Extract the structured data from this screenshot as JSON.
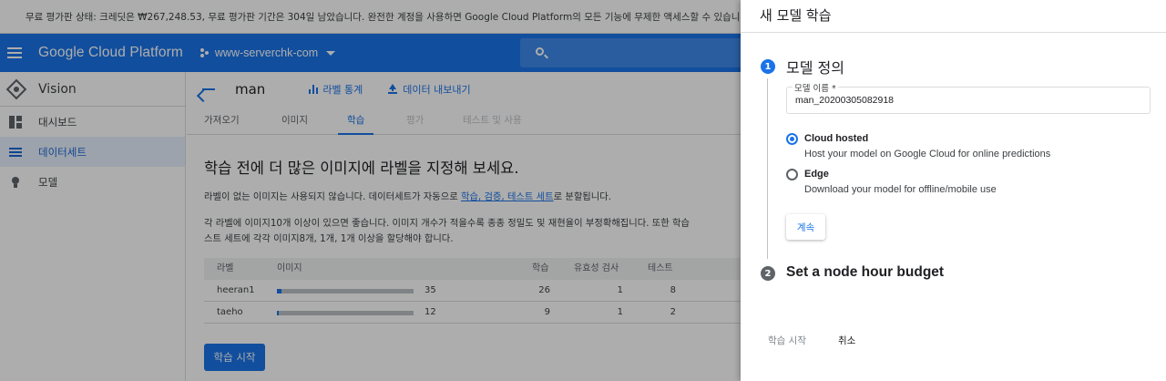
{
  "banner": {
    "text": "무료 평가판 상태: 크레딧은 ₩267,248.53, 무료 평가판 기간은 304일 남았습니다. 완전한 계정을 사용하면 Google Cloud Platform의 모든 기능에 무제한 액세스할 수 있습니다."
  },
  "topbar": {
    "title": "Google Cloud Platform",
    "project": "www-serverchk-com"
  },
  "sidebar": {
    "product": "Vision",
    "items": [
      {
        "label": "대시보드"
      },
      {
        "label": "데이터세트",
        "active": true
      },
      {
        "label": "모델"
      }
    ]
  },
  "header": {
    "dataset": "man",
    "stats_label": "라벨 통계",
    "export_label": "데이터 내보내기"
  },
  "tabs": [
    {
      "label": "가져오기"
    },
    {
      "label": "이미지"
    },
    {
      "label": "학습",
      "active": true
    },
    {
      "label": "평가",
      "disabled": true
    },
    {
      "label": "테스트 및 사용",
      "disabled": true
    }
  ],
  "main": {
    "heading": "학습 전에 더 많은 이미지에 라벨을 지정해 보세요.",
    "para1_before": "라벨이 없는 이미지는 사용되지 않습니다. 데이터세트가 자동으로 ",
    "para1_link": "학습, 검증, 테스트 세트",
    "para1_after": "로 분할됩니다.",
    "para2_line1": "각 라벨에 이미지10개 이상이 있으면 좋습니다. 이미지 개수가 적을수록 종종 정밀도 및 재현율이 부정확해집니다. 또한 학습",
    "para2_line2": "스트 세트에 각각 이미지8개, 1개, 1개 이상을 할당해야 합니다.",
    "train_button": "학습 시작"
  },
  "table": {
    "headers": {
      "label": "라벨",
      "images": "이미지",
      "train": "학습",
      "validation": "유효성 검사",
      "test": "테스트"
    },
    "rows": [
      {
        "label": "heeran1",
        "images": "35",
        "progress": 0.035,
        "train": "26",
        "validation": "1",
        "test": "8"
      },
      {
        "label": "taeho",
        "images": "12",
        "progress": 0.012,
        "train": "9",
        "validation": "1",
        "test": "2"
      }
    ]
  },
  "panel": {
    "title": "새 모델 학습",
    "step1": {
      "number": "1",
      "title": "모델 정의"
    },
    "field": {
      "label": "모델 이름 *",
      "value": "man_20200305082918"
    },
    "options": [
      {
        "title": "Cloud hosted",
        "desc": "Host your model on Google Cloud for online predictions",
        "checked": true
      },
      {
        "title": "Edge",
        "desc": "Download your model for offline/mobile use",
        "checked": false
      }
    ],
    "continue_label": "계속",
    "step2": {
      "number": "2",
      "title": "Set a node hour budget"
    },
    "start_label": "학습 시작",
    "cancel_label": "취소"
  },
  "colors": {
    "accent": "#1a73e8",
    "scrim": "rgba(0,0,0,0.32)",
    "inactive_step": "#5f6368"
  }
}
